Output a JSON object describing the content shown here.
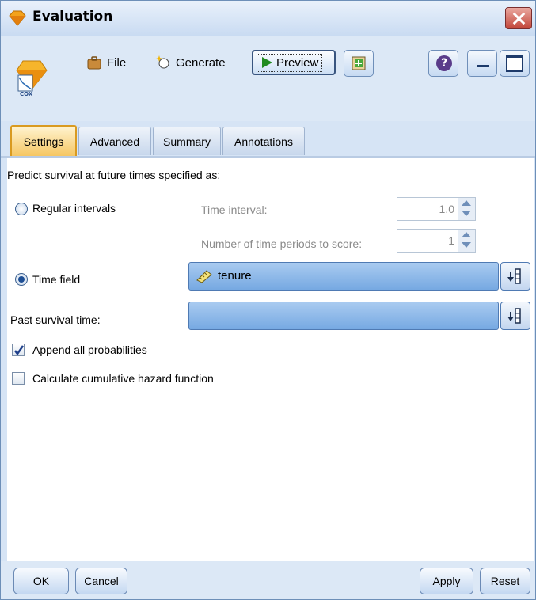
{
  "window": {
    "title": "Evaluation"
  },
  "node": {
    "badge": "COX"
  },
  "toolbar": {
    "file_label": "File",
    "generate_label": "Generate",
    "preview_label": "Preview"
  },
  "tabs": [
    {
      "label": "Settings",
      "active": true
    },
    {
      "label": "Advanced",
      "active": false
    },
    {
      "label": "Summary",
      "active": false
    },
    {
      "label": "Annotations",
      "active": false
    }
  ],
  "settings": {
    "heading": "Predict survival at future times specified as:",
    "regular_intervals_label": "Regular intervals",
    "time_interval_label": "Time interval:",
    "time_interval_value": "1.0",
    "num_periods_label": "Number of time periods to score:",
    "num_periods_value": "1",
    "time_field_label": "Time field",
    "time_field_value": "tenure",
    "selected_mode": "Time field",
    "past_survival_label": "Past survival time:",
    "past_survival_value": "",
    "append_probabilities_label": "Append all probabilities",
    "append_probabilities_checked": true,
    "cumulative_hazard_label": "Calculate cumulative hazard function",
    "cumulative_hazard_checked": false
  },
  "buttons": {
    "ok": "OK",
    "cancel": "Cancel",
    "apply": "Apply",
    "reset": "Reset"
  },
  "colors": {
    "active_tab": "#f5c560",
    "field_fill": "#8fbbea",
    "close": "#c2463a"
  }
}
